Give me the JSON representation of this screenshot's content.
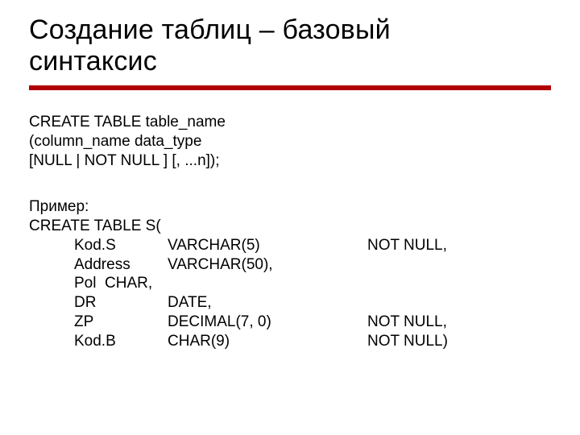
{
  "title_line1": "Создание таблиц – базовый",
  "title_line2": "синтаксис",
  "syntax": {
    "l1": "CREATE TABLE table_name",
    "l2": "(column_name data_type",
    "l3": "[NULL | NOT NULL ] [, ...n]);"
  },
  "example": {
    "label": "Пример:",
    "open": "CREATE TABLE S(",
    "rows": [
      {
        "name": "Kod.S",
        "type": "VARCHAR(5)",
        "extra_indent": "",
        "constraint": "NOT NULL,"
      },
      {
        "name": "Address",
        "type": "VARCHAR(50),",
        "extra_indent": "",
        "constraint": ""
      },
      {
        "name": "Pol",
        "type": "CHAR,",
        "extra_indent": "",
        "constraint": ""
      },
      {
        "name": "DR",
        "type": "DATE,",
        "extra_indent": "",
        "constraint": ""
      },
      {
        "name": "ZP",
        "type": "DECIMAL(7, 0)",
        "extra_indent": "        ",
        "constraint": "NOT NULL,"
      },
      {
        "name": "Kod.B",
        "type": "CHAR(9)",
        "extra_indent": "        ",
        "constraint": "NOT NULL)"
      }
    ]
  },
  "pol_inline": "Pol  CHAR,"
}
